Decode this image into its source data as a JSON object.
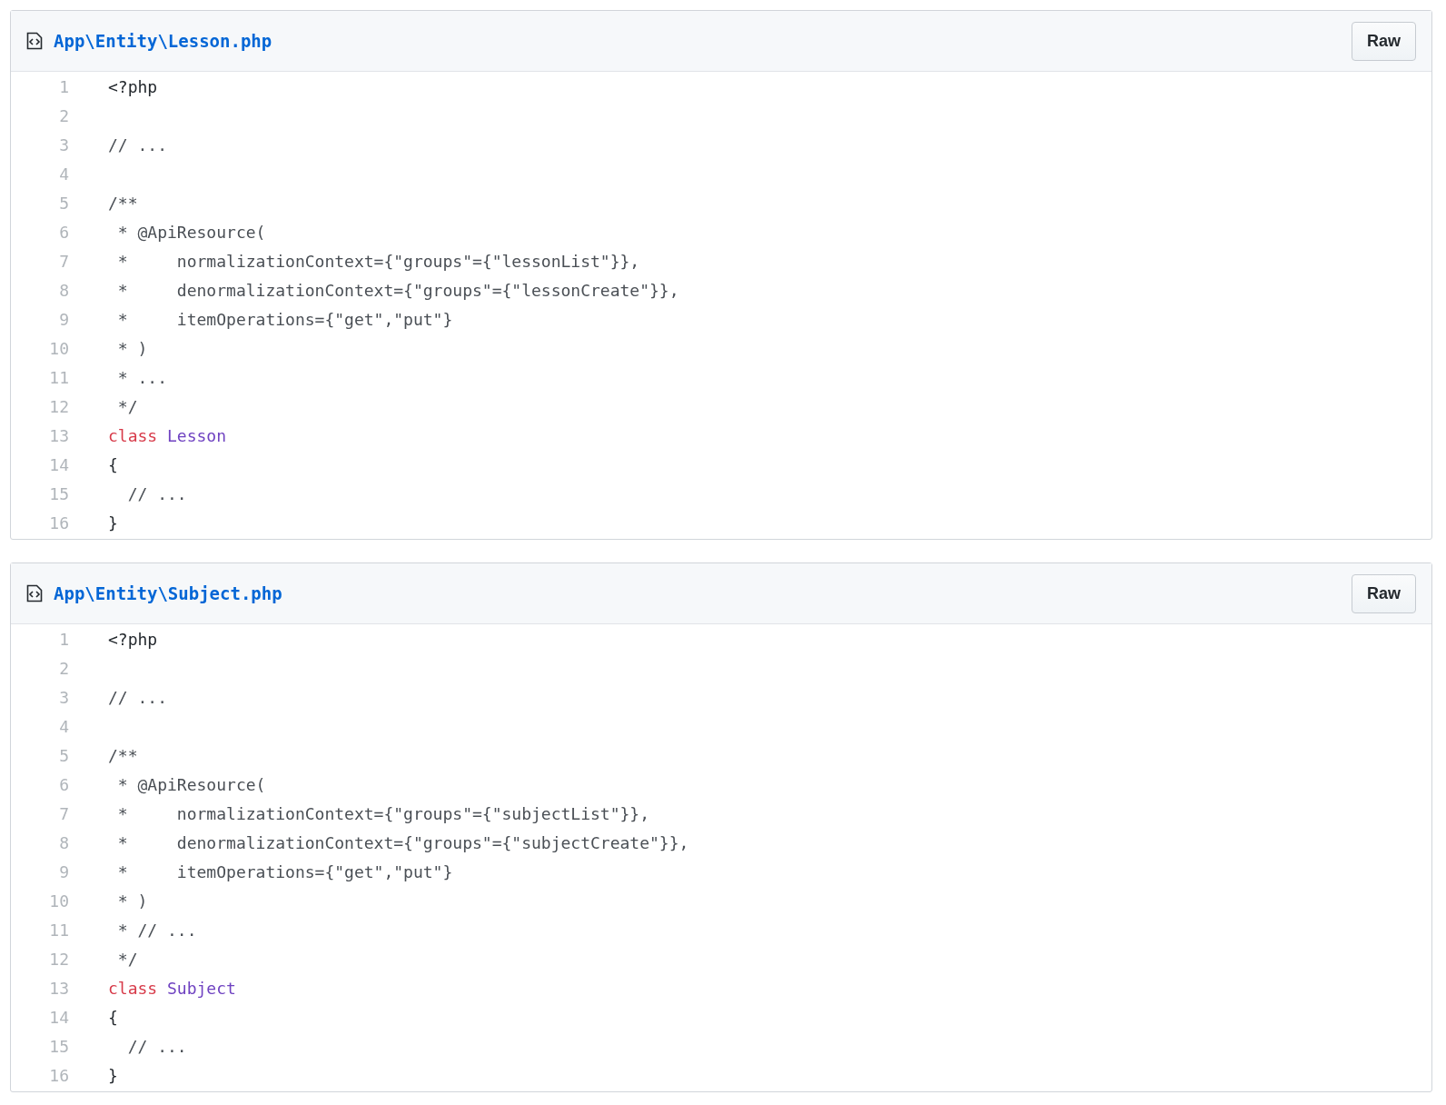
{
  "files": [
    {
      "name": "App\\Entity\\Lesson.php",
      "button": "Raw",
      "lines": [
        {
          "number": "1",
          "tokens": [
            {
              "text": "<?php",
              "kind": "plain"
            }
          ]
        },
        {
          "number": "2"
        },
        {
          "number": "3",
          "tokens": [
            {
              "text": "// ...",
              "kind": "comment"
            }
          ]
        },
        {
          "number": "4"
        },
        {
          "number": "5",
          "tokens": [
            {
              "text": "/**",
              "kind": "comment"
            }
          ]
        },
        {
          "number": "6",
          "tokens": [
            {
              "text": " * @ApiResource(",
              "kind": "comment"
            }
          ]
        },
        {
          "number": "7",
          "tokens": [
            {
              "text": " *     normalizationContext={\"groups\"={\"lessonList\"}},",
              "kind": "comment"
            }
          ]
        },
        {
          "number": "8",
          "tokens": [
            {
              "text": " *     denormalizationContext={\"groups\"={\"lessonCreate\"}},",
              "kind": "comment"
            }
          ]
        },
        {
          "number": "9",
          "tokens": [
            {
              "text": " *     itemOperations={\"get\",\"put\"}",
              "kind": "comment"
            }
          ]
        },
        {
          "number": "10",
          "tokens": [
            {
              "text": " * )",
              "kind": "comment"
            }
          ]
        },
        {
          "number": "11",
          "tokens": [
            {
              "text": " * ...",
              "kind": "comment"
            }
          ]
        },
        {
          "number": "12",
          "tokens": [
            {
              "text": " */",
              "kind": "comment"
            }
          ]
        },
        {
          "number": "13",
          "tokens": [
            {
              "text": "class",
              "kind": "keyword"
            },
            {
              "text": "Lesson",
              "kind": "entity"
            }
          ]
        },
        {
          "number": "14",
          "tokens": [
            {
              "text": "{",
              "kind": "plain"
            }
          ]
        },
        {
          "number": "15",
          "tokens": [
            {
              "text": "  // ...",
              "kind": "comment"
            }
          ]
        },
        {
          "number": "16",
          "tokens": [
            {
              "text": "}",
              "kind": "plain"
            }
          ]
        }
      ]
    },
    {
      "name": "App\\Entity\\Subject.php",
      "button": "Raw",
      "lines": [
        {
          "number": "1",
          "tokens": [
            {
              "text": "<?php",
              "kind": "plain"
            }
          ]
        },
        {
          "number": "2"
        },
        {
          "number": "3",
          "tokens": [
            {
              "text": "// ...",
              "kind": "comment"
            }
          ]
        },
        {
          "number": "4"
        },
        {
          "number": "5",
          "tokens": [
            {
              "text": "/**",
              "kind": "comment"
            }
          ]
        },
        {
          "number": "6",
          "tokens": [
            {
              "text": " * @ApiResource(",
              "kind": "comment"
            }
          ]
        },
        {
          "number": "7",
          "tokens": [
            {
              "text": " *     normalizationContext={\"groups\"={\"subjectList\"}},",
              "kind": "comment"
            }
          ]
        },
        {
          "number": "8",
          "tokens": [
            {
              "text": " *     denormalizationContext={\"groups\"={\"subjectCreate\"}},",
              "kind": "comment"
            }
          ]
        },
        {
          "number": "9",
          "tokens": [
            {
              "text": " *     itemOperations={\"get\",\"put\"}",
              "kind": "comment"
            }
          ]
        },
        {
          "number": "10",
          "tokens": [
            {
              "text": " * )",
              "kind": "comment"
            }
          ]
        },
        {
          "number": "11",
          "tokens": [
            {
              "text": " * // ...",
              "kind": "comment"
            }
          ]
        },
        {
          "number": "12",
          "tokens": [
            {
              "text": " */",
              "kind": "comment"
            }
          ]
        },
        {
          "number": "13",
          "tokens": [
            {
              "text": "class",
              "kind": "keyword"
            },
            {
              "text": "Subject",
              "kind": "entity"
            }
          ]
        },
        {
          "number": "14",
          "tokens": [
            {
              "text": "{",
              "kind": "plain"
            }
          ]
        },
        {
          "number": "15",
          "tokens": [
            {
              "text": "  // ...",
              "kind": "comment"
            }
          ]
        },
        {
          "number": "16",
          "tokens": [
            {
              "text": "}",
              "kind": "plain"
            }
          ]
        }
      ]
    }
  ]
}
